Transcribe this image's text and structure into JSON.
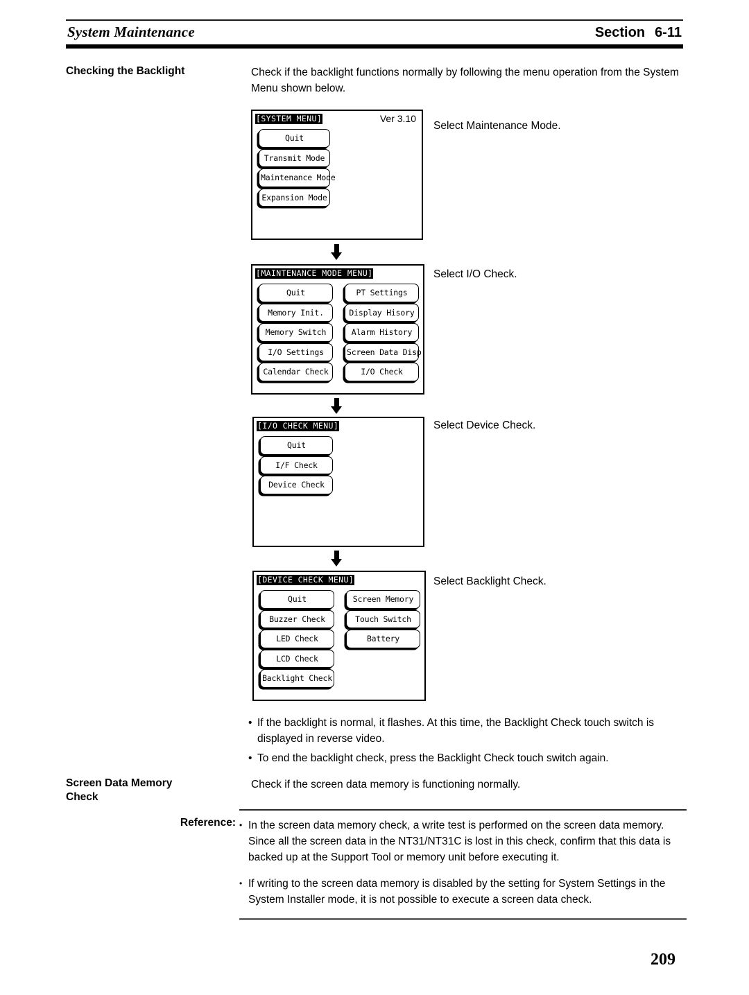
{
  "header": {
    "running_title": "System Maintenance",
    "section_word": "Section",
    "section_number": "6-11"
  },
  "sections": {
    "backlight": {
      "label": "Checking the Backlight",
      "intro": "Check if the backlight functions normally by following the menu operation from the System Menu shown below."
    },
    "screen_data_memory": {
      "label_line1": "Screen Data Memory",
      "label_line2": "Check",
      "text": "Check if the screen data memory is functioning normally."
    }
  },
  "steps": [
    {
      "caption": "Select Maintenance Mode."
    },
    {
      "caption": "Select I/O Check."
    },
    {
      "caption": "Select Device Check."
    },
    {
      "caption": "Select Backlight Check."
    }
  ],
  "pt_screens": [
    {
      "title": "[SYSTEM MENU]",
      "version": "Ver 3.10",
      "columns": [
        {
          "buttons": [
            "Quit",
            "Transmit Mode",
            "Maintenance Mode",
            "Expansion Mode"
          ]
        }
      ]
    },
    {
      "title": "[MAINTENANCE MODE MENU]",
      "version": "",
      "columns": [
        {
          "buttons": [
            "Quit",
            "Memory Init.",
            "Memory Switch",
            "I/O Settings",
            "Calendar Check"
          ]
        },
        {
          "buttons": [
            "PT Settings",
            "Display Hisory",
            "Alarm History",
            "Screen Data Disp.",
            "I/O Check"
          ]
        }
      ]
    },
    {
      "title": "[I/O CHECK MENU]",
      "version": "",
      "columns": [
        {
          "buttons": [
            "Quit",
            "I/F Check",
            "Device Check"
          ]
        }
      ]
    },
    {
      "title": "[DEVICE CHECK MENU]",
      "version": "",
      "columns": [
        {
          "buttons": [
            "Quit",
            "Buzzer Check",
            "LED Check",
            "LCD Check",
            "Backlight Check"
          ]
        },
        {
          "buttons": [
            "Screen Memory",
            "Touch Switch",
            "Battery"
          ]
        }
      ]
    }
  ],
  "backlight_notes": [
    {
      "bullet": "•",
      "text": "If the backlight is normal, it flashes. At this time, the Backlight Check touch switch is displayed in reverse video."
    },
    {
      "bullet": "•",
      "text": "To end the backlight check, press the Backlight Check touch switch again."
    }
  ],
  "reference": {
    "label": "Reference:",
    "items": [
      {
        "bullet": "•",
        "text": "In the screen data memory check, a write test is performed on the screen data memory. Since all the screen data in the NT31/NT31C is lost in this check, confirm that this data is backed up at the Support Tool or memory unit before executing it."
      },
      {
        "bullet": "•",
        "text": "If writing to the screen data memory is disabled by the setting for System Settings in the System Installer mode, it is not possible to execute a screen data check."
      }
    ]
  },
  "footer": {
    "page_number": "209"
  }
}
